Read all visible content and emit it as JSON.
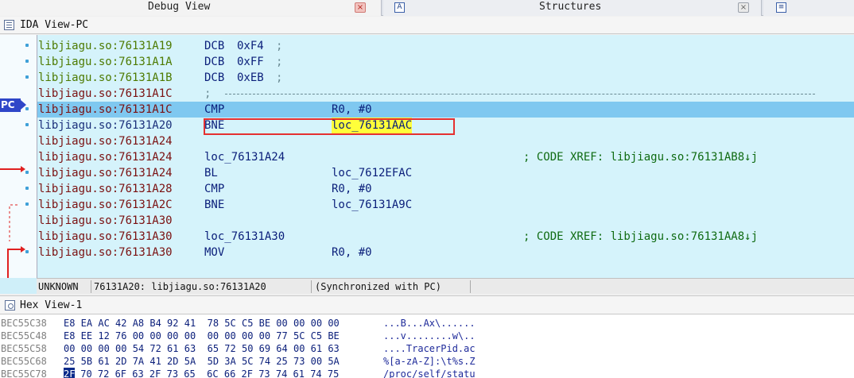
{
  "tabs": [
    {
      "label": "Debug View",
      "close": "×"
    },
    {
      "label": "Structures",
      "close": "×",
      "icon": "A"
    },
    {
      "label": "",
      "icon": "≡"
    }
  ],
  "ida_view": {
    "title": "IDA View-PC",
    "pc_label": "PC",
    "lines": [
      {
        "addr": "libjiagu.so:76131A19",
        "mn": "DCB",
        "op": "0xF4",
        "comment": ";",
        "style": "green"
      },
      {
        "addr": "libjiagu.so:76131A1A",
        "mn": "DCB",
        "op": "0xFF",
        "comment": ";",
        "style": "green"
      },
      {
        "addr": "libjiagu.so:76131A1B",
        "mn": "DCB",
        "op": "0xEB",
        "comment": ";",
        "style": "green"
      },
      {
        "addr": "libjiagu.so:76131A1C",
        "mn": "",
        "op": "",
        "comment": ";",
        "style": "red"
      },
      {
        "addr": "libjiagu.so:76131A1C",
        "mn": "CMP",
        "op": "R0, #0",
        "comment": "",
        "style": "red"
      },
      {
        "addr": "libjiagu.so:76131A20",
        "mn": "BNE",
        "op": "loc_76131AAC",
        "comment": "",
        "style": "navy"
      },
      {
        "addr": "libjiagu.so:76131A24",
        "mn": "",
        "op": "",
        "comment": "",
        "style": "red"
      },
      {
        "addr": "libjiagu.so:76131A24",
        "mn": "loc_76131A24",
        "op": "",
        "comment": "; CODE XREF: libjiagu.so:76131AB8↓j",
        "style": "red"
      },
      {
        "addr": "libjiagu.so:76131A24",
        "mn": "BL",
        "op": "loc_7612EFAC",
        "comment": "",
        "style": "red"
      },
      {
        "addr": "libjiagu.so:76131A28",
        "mn": "CMP",
        "op": "R0, #0",
        "comment": "",
        "style": "red"
      },
      {
        "addr": "libjiagu.so:76131A2C",
        "mn": "BNE",
        "op": "loc_76131A9C",
        "comment": "",
        "style": "red"
      },
      {
        "addr": "libjiagu.so:76131A30",
        "mn": "",
        "op": "",
        "comment": "",
        "style": "red"
      },
      {
        "addr": "libjiagu.so:76131A30",
        "mn": "loc_76131A30",
        "op": "",
        "comment": "; CODE XREF: libjiagu.so:76131AA8↓j",
        "style": "red"
      },
      {
        "addr": "libjiagu.so:76131A30",
        "mn": "MOV",
        "op": "R0, #0",
        "comment": "",
        "style": "red"
      }
    ],
    "status": {
      "segment": "UNKNOWN",
      "location": "76131A20: libjiagu.so:76131A20",
      "sync": "(Synchronized with PC)"
    }
  },
  "hex_view": {
    "title": "Hex View-1",
    "rows": [
      {
        "addr": "BEC55C38",
        "bytes": "E8 EA AC 42 A8 B4 92 41  78 5C C5 BE 00 00 00 00",
        "ascii": "...B...Ax\\......"
      },
      {
        "addr": "BEC55C48",
        "bytes": "E8 EE 12 76 00 00 00 00  00 00 00 00 77 5C C5 BE",
        "ascii": "...v........w\\.."
      },
      {
        "addr": "BEC55C58",
        "bytes": "00 00 00 00 54 72 61 63  65 72 50 69 64 00 61 63",
        "ascii": "....TracerPid.ac"
      },
      {
        "addr": "BEC55C68",
        "bytes": "25 5B 61 2D 7A 41 2D 5A  5D 3A 5C 74 25 73 00 5A",
        "ascii": "%[a-zA-Z]:\\t%s.Z"
      },
      {
        "addr": "BEC55C78",
        "cursor_byte": "2F",
        "bytes": " 70 72 6F 63 2F 73 65  6C 66 2F 73 74 61 74 75",
        "ascii": "/proc/self/statu"
      }
    ]
  },
  "colors": {
    "disasm_bg": "#d5f3fb",
    "selection": "#7fc8f0",
    "highlight": "#ffff3a",
    "annotation_box": "#e53030",
    "pc_tag": "#2f46c8"
  }
}
